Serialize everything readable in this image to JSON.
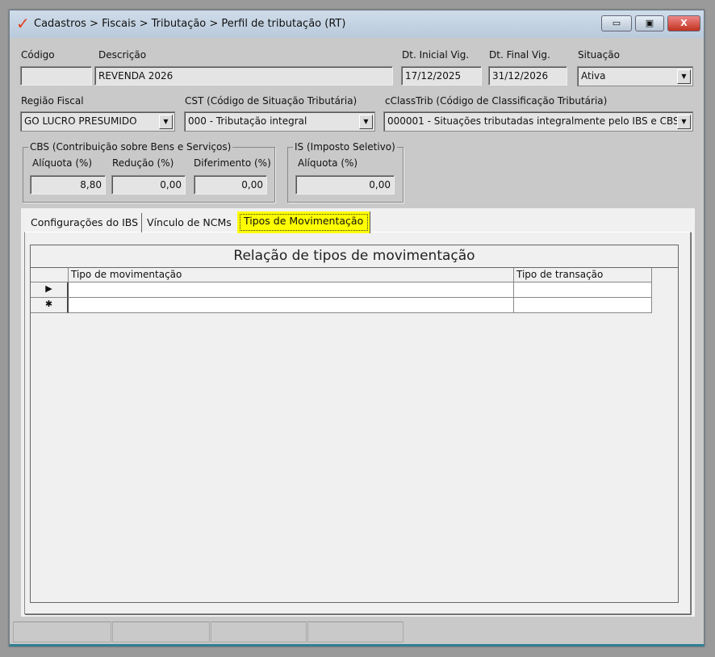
{
  "window": {
    "title": "Cadastros > Fiscais > Tributação > Perfil de tributação (RT)",
    "minimize": "▭",
    "maximize": "▣",
    "close": "X",
    "accent": "#e0401c"
  },
  "form": {
    "codigo": {
      "label": "Código",
      "value": ""
    },
    "descricao": {
      "label": "Descrição",
      "value": "REVENDA 2026"
    },
    "dt_inicial": {
      "label": "Dt. Inicial Vig.",
      "value": "17/12/2025"
    },
    "dt_final": {
      "label": "Dt. Final Vig.",
      "value": "31/12/2026"
    },
    "situacao": {
      "label": "Situação",
      "value": "Ativa"
    },
    "regiao": {
      "label": "Região Fiscal",
      "value": "GO LUCRO PRESUMIDO"
    },
    "cst": {
      "label": "CST (Código de Situação Tributária)",
      "value": "000 - Tributação integral"
    },
    "cclasstrib": {
      "label": "cClassTrib (Código de Classificação Tributária)",
      "value": "000001 - Situações tributadas integralmente pelo IBS e CBS"
    }
  },
  "cbs": {
    "title": "CBS (Contribuição sobre Bens e Serviços)",
    "aliquota_label": "Alíquota (%)",
    "aliquota": "8,80",
    "reducao_label": "Redução (%)",
    "reducao": "0,00",
    "diferimento_label": "Diferimento (%)",
    "diferimento": "0,00"
  },
  "is": {
    "title": "IS (Imposto Seletivo)",
    "aliquota_label": "Alíquota (%)",
    "aliquota": "0,00"
  },
  "tabs": [
    {
      "label": "Configurações do IBS"
    },
    {
      "label": "Vínculo de NCMs"
    },
    {
      "label": "Tipos de Movimentação"
    }
  ],
  "grid": {
    "title": "Relação de tipos de movimentação",
    "columns": [
      "Tipo de movimentação",
      "Tipo de transação"
    ],
    "row_indicators": [
      "▶",
      "✱"
    ]
  },
  "highlight_color": "#ffff00"
}
